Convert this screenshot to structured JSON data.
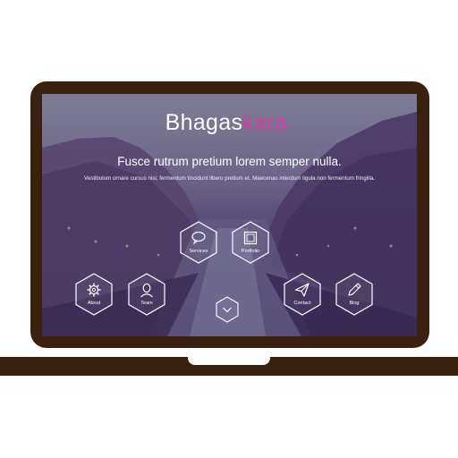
{
  "brand": {
    "main": "Bhagas",
    "accent": "kara",
    "dot": "."
  },
  "hero": {
    "tagline": "Fusce rutrum pretium lorem semper nulla.",
    "subtext": "Vestibulum ornare cursus nisl, fermentum tincidunt libero pretium et. Maecenas interdum ligula non fermentum fringilla."
  },
  "nav": {
    "services": "Services",
    "portfolio": "Portfolio",
    "about": "About",
    "team": "Team",
    "contact": "Contact",
    "blog": "Blog"
  },
  "colors": {
    "accent": "#d63ea6",
    "frame": "#3a200f"
  }
}
